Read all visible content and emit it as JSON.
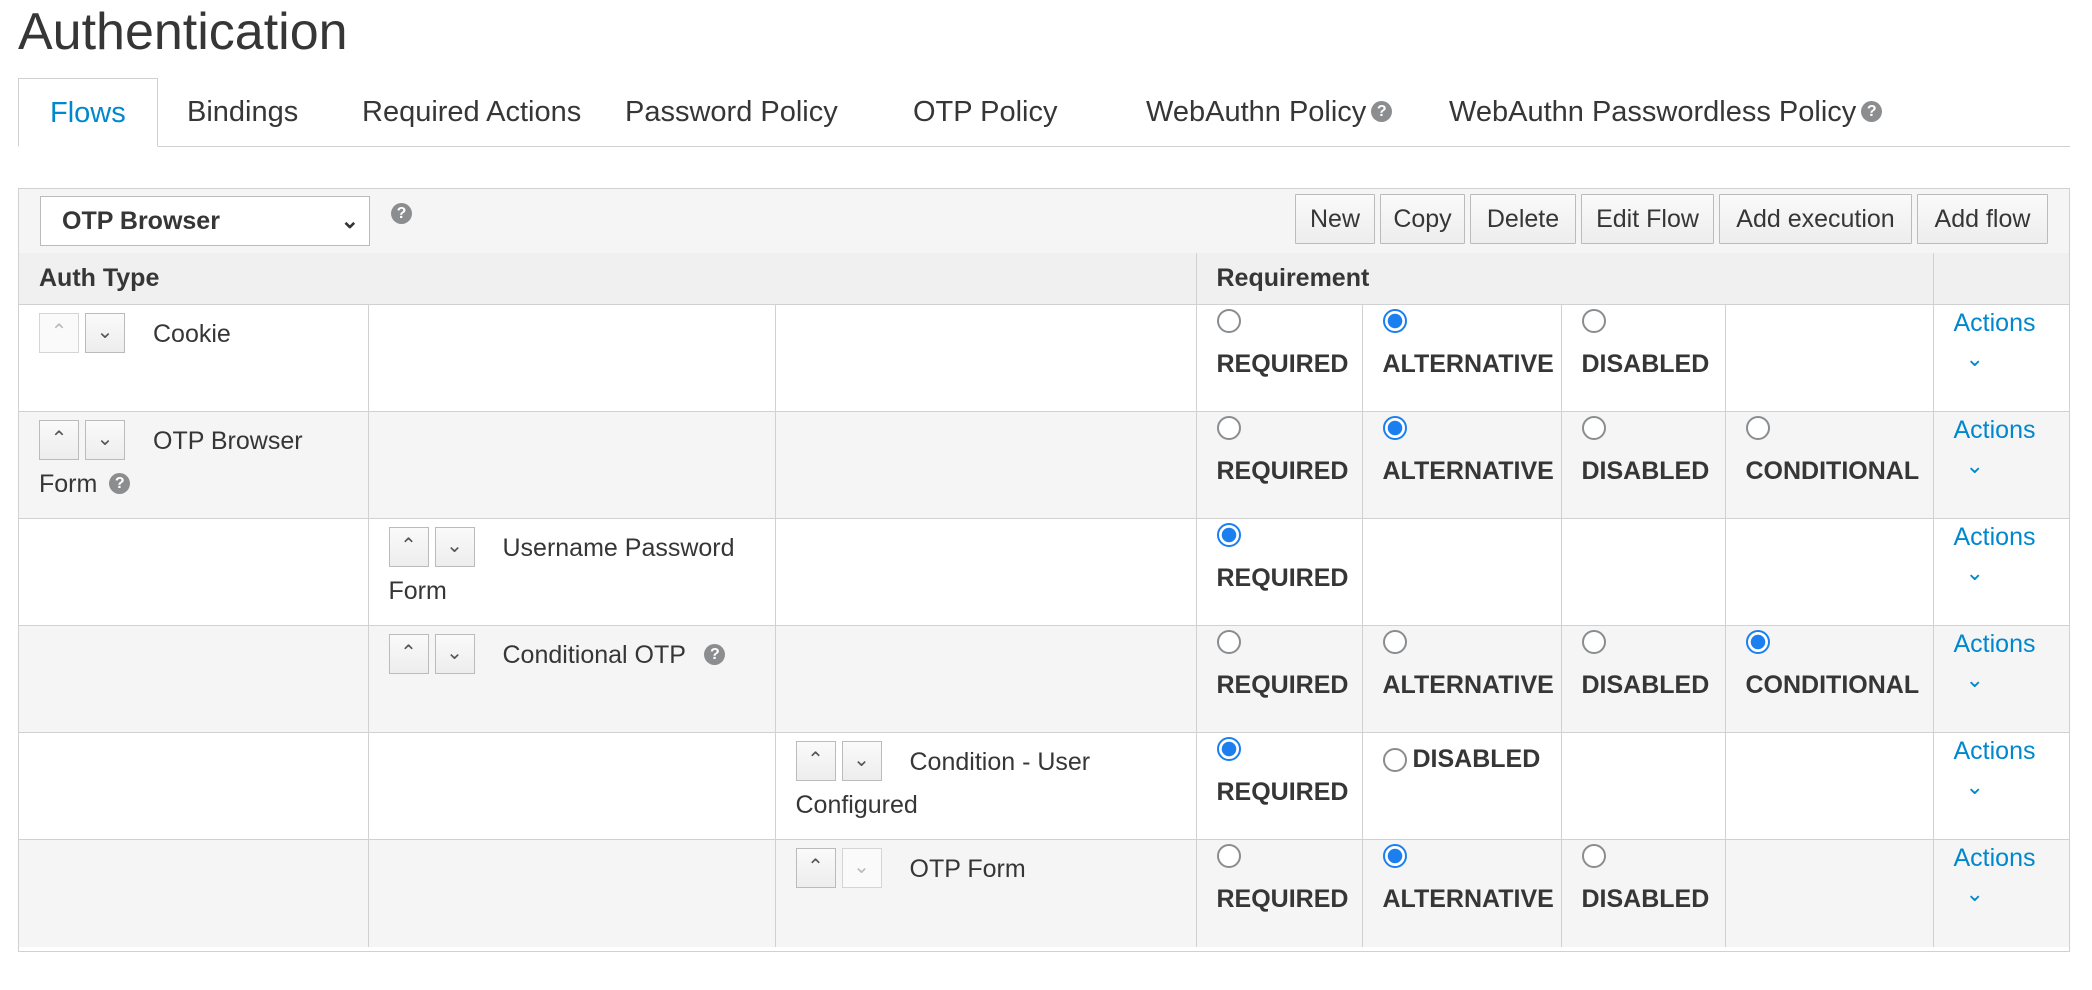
{
  "page": {
    "title": "Authentication"
  },
  "tabs": [
    {
      "label": "Flows",
      "active": true
    },
    {
      "label": "Bindings"
    },
    {
      "label": "Required Actions"
    },
    {
      "label": "Password Policy"
    },
    {
      "label": "OTP Policy"
    },
    {
      "label": "WebAuthn Policy",
      "help": true
    },
    {
      "label": "WebAuthn Passwordless Policy",
      "help": true
    }
  ],
  "toolbar": {
    "flow_select": "OTP Browser",
    "buttons": {
      "new": "New",
      "copy": "Copy",
      "delete": "Delete",
      "edit_flow": "Edit Flow",
      "add_execution": "Add execution",
      "add_flow": "Add flow"
    }
  },
  "table": {
    "headers": {
      "auth_type": "Auth Type",
      "requirement": "Requirement"
    },
    "actions_label": "Actions",
    "rows": [
      {
        "name": "Cookie",
        "level": 0,
        "options": [
          {
            "label": "REQUIRED",
            "checked": false
          },
          {
            "label": "ALTERNATIVE",
            "checked": true
          },
          {
            "label": "DISABLED",
            "checked": false
          }
        ]
      },
      {
        "name": "OTP Browser Form",
        "level": 0,
        "help": true,
        "options": [
          {
            "label": "REQUIRED",
            "checked": false
          },
          {
            "label": "ALTERNATIVE",
            "checked": true
          },
          {
            "label": "DISABLED",
            "checked": false
          },
          {
            "label": "CONDITIONAL",
            "checked": false
          }
        ]
      },
      {
        "name": "Username Password Form",
        "level": 1,
        "options": [
          {
            "label": "REQUIRED",
            "checked": true
          }
        ]
      },
      {
        "name": "Conditional OTP",
        "level": 1,
        "help": true,
        "options": [
          {
            "label": "REQUIRED",
            "checked": false
          },
          {
            "label": "ALTERNATIVE",
            "checked": false
          },
          {
            "label": "DISABLED",
            "checked": false
          },
          {
            "label": "CONDITIONAL",
            "checked": true
          }
        ]
      },
      {
        "name": "Condition - User Configured",
        "level": 2,
        "options": [
          {
            "label": "REQUIRED",
            "checked": true
          },
          {
            "label": "DISABLED",
            "checked": false
          }
        ]
      },
      {
        "name": "OTP Form",
        "level": 2,
        "options": [
          {
            "label": "REQUIRED",
            "checked": false
          },
          {
            "label": "ALTERNATIVE",
            "checked": true
          },
          {
            "label": "DISABLED",
            "checked": false
          }
        ]
      }
    ]
  }
}
